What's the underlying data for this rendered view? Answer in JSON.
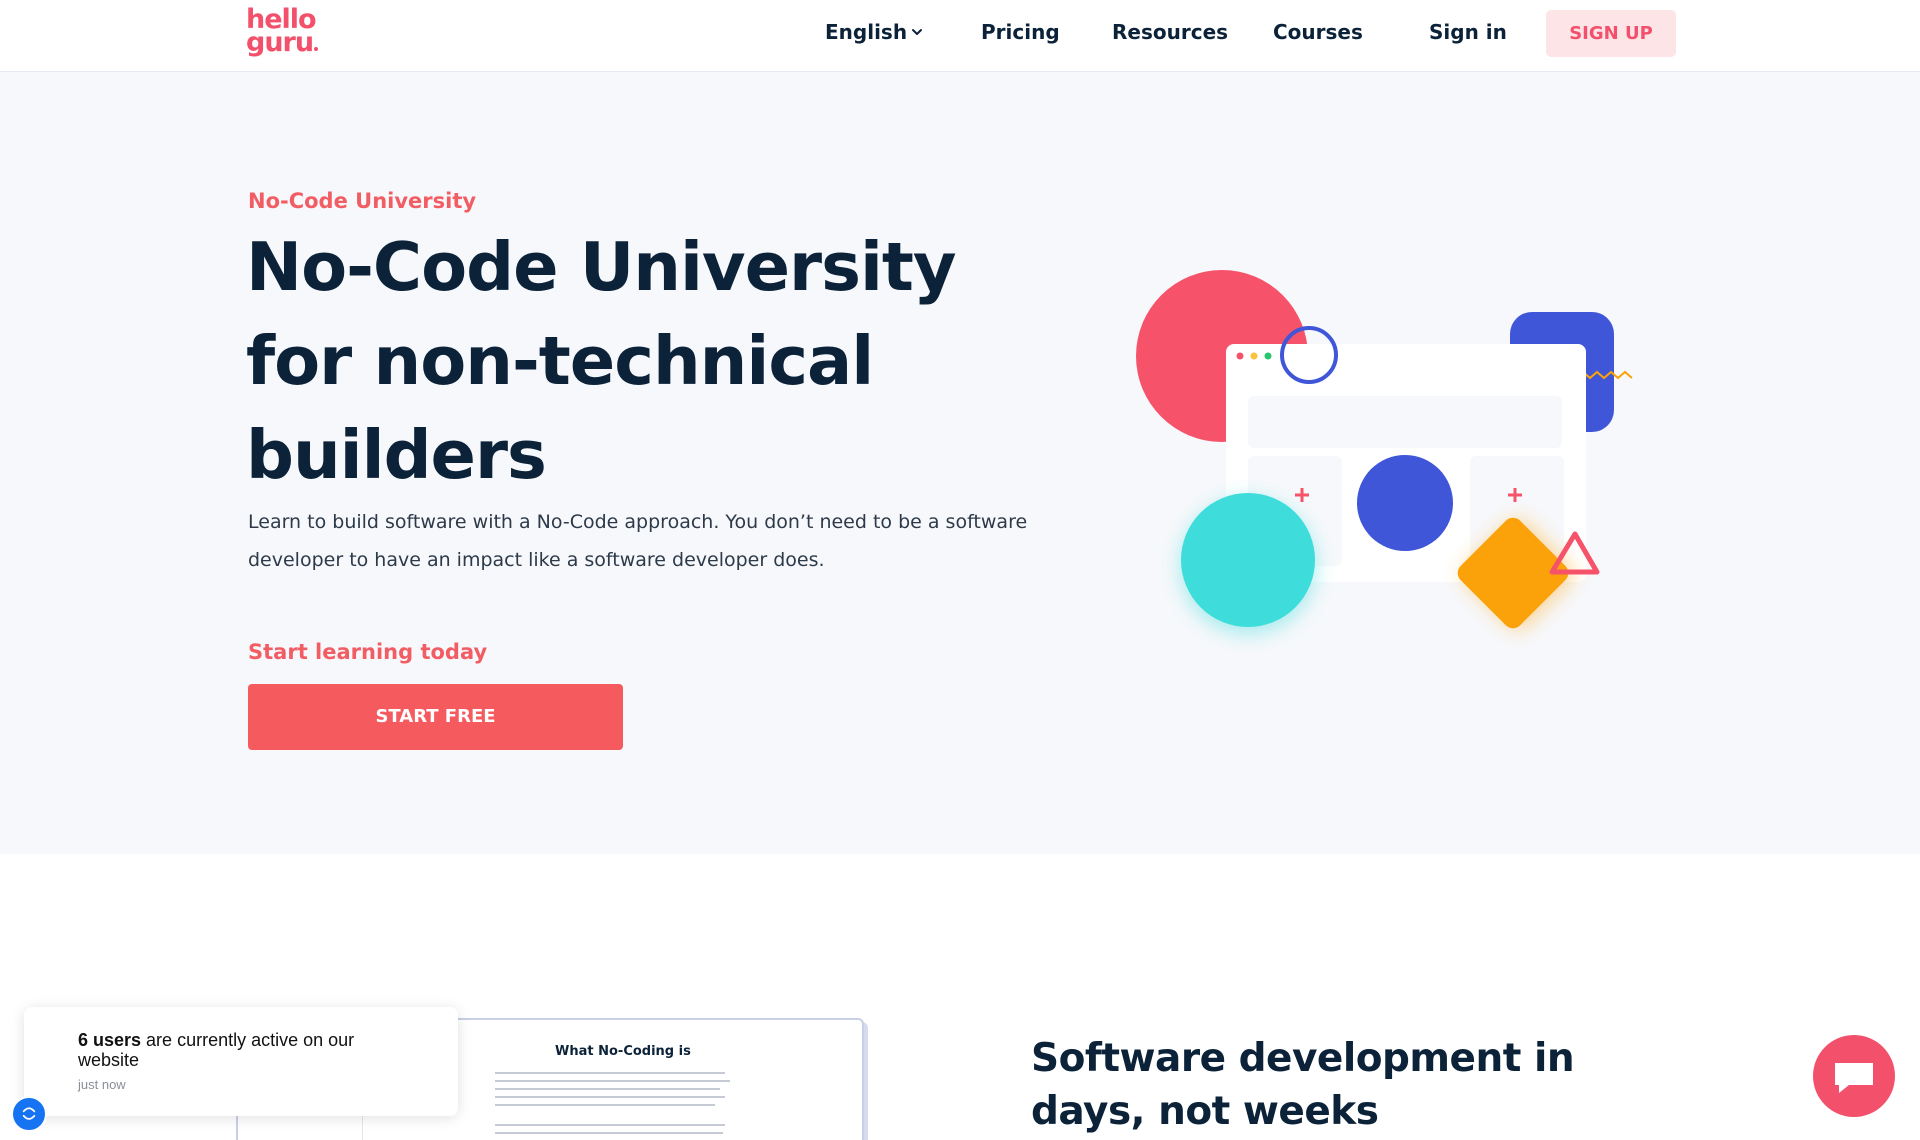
{
  "header": {
    "logo_top": "hello",
    "logo_bottom": "guru",
    "nav": {
      "language": "English",
      "pricing": "Pricing",
      "resources": "Resources",
      "courses": "Courses",
      "sign_in": "Sign in",
      "sign_up": "SIGN UP"
    }
  },
  "hero": {
    "eyebrow": "No-Code University",
    "title_line1": "No-Code University",
    "title_line2": "for non-technical",
    "title_line3": "builders",
    "description": "Learn to build software with a No-Code approach. You don’t need to be a software developer to have an impact like a software developer does.",
    "cta_label": "Start learning today",
    "cta_button": "START FREE"
  },
  "preview": {
    "doc_title": "What No-Coding is"
  },
  "section": {
    "title": "Software development in days, not weeks"
  },
  "toast": {
    "count": "6 users",
    "text": " are currently active on our website",
    "time": "just now"
  },
  "colors": {
    "brand": "#f2506b",
    "cta": "#f55a5f",
    "navy": "#0b2239",
    "blue": "#3f56d8",
    "teal": "#3fdcdc",
    "orange": "#fba20b"
  },
  "icons": {
    "language_dropdown": "chevron-down-icon",
    "chat": "chat-bubble-icon",
    "notification": "notification-badge-icon"
  }
}
